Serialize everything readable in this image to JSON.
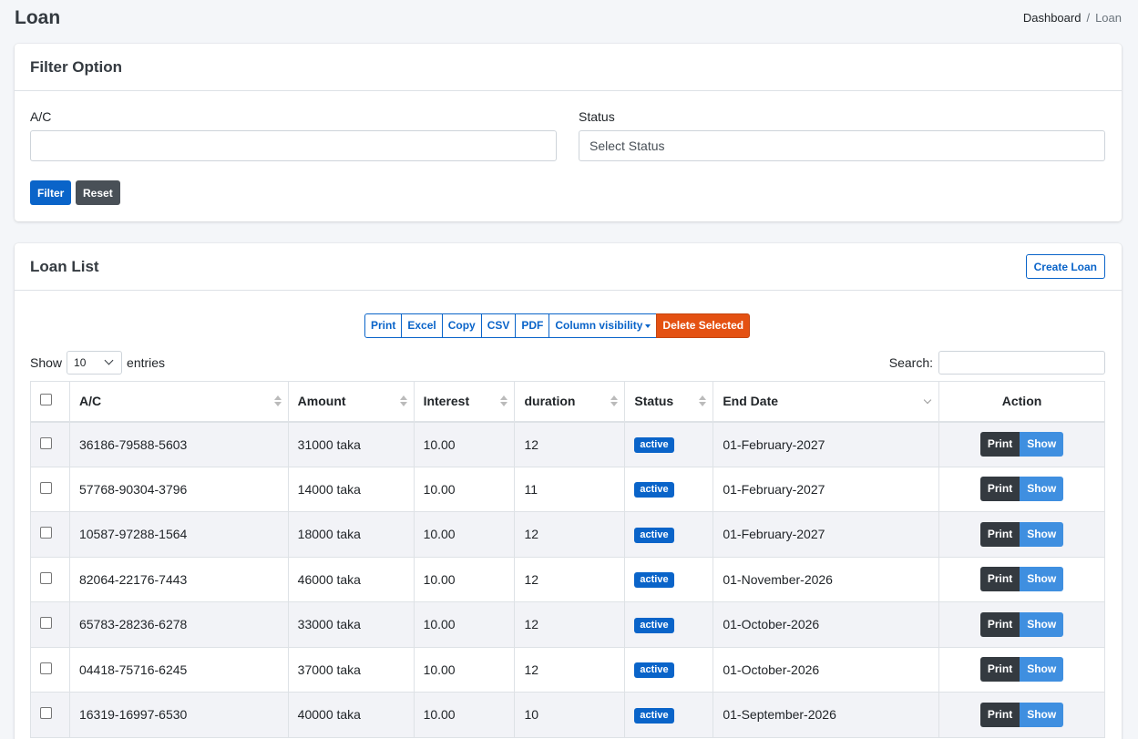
{
  "header": {
    "title": "Loan",
    "breadcrumb": [
      "Dashboard",
      "Loan"
    ]
  },
  "filter": {
    "title": "Filter Option",
    "ac_label": "A/C",
    "ac_value": "",
    "status_label": "Status",
    "status_value": "Select Status",
    "filter_button": "Filter",
    "reset_button": "Reset"
  },
  "list": {
    "title": "Loan List",
    "create_button": "Create Loan",
    "export_buttons": [
      "Print",
      "Excel",
      "Copy",
      "CSV",
      "PDF",
      "Column visibility"
    ],
    "delete_button": "Delete Selected",
    "show_label": "Show",
    "entries_value": "10",
    "entries_label": "entries",
    "search_label": "Search:",
    "columns": [
      "A/C",
      "Amount",
      "Interest",
      "duration",
      "Status",
      "End Date",
      "Action"
    ],
    "row_actions": {
      "print": "Print",
      "show": "Show"
    },
    "rows": [
      {
        "ac": "36186-79588-5603",
        "amount": "31000 taka",
        "interest": "10.00",
        "duration": "12",
        "status": "active",
        "end_date": "01-February-2027"
      },
      {
        "ac": "57768-90304-3796",
        "amount": "14000 taka",
        "interest": "10.00",
        "duration": "11",
        "status": "active",
        "end_date": "01-February-2027"
      },
      {
        "ac": "10587-97288-1564",
        "amount": "18000 taka",
        "interest": "10.00",
        "duration": "12",
        "status": "active",
        "end_date": "01-February-2027"
      },
      {
        "ac": "82064-22176-7443",
        "amount": "46000 taka",
        "interest": "10.00",
        "duration": "12",
        "status": "active",
        "end_date": "01-November-2026"
      },
      {
        "ac": "65783-28236-6278",
        "amount": "33000 taka",
        "interest": "10.00",
        "duration": "12",
        "status": "active",
        "end_date": "01-October-2026"
      },
      {
        "ac": "04418-75716-6245",
        "amount": "37000 taka",
        "interest": "10.00",
        "duration": "12",
        "status": "active",
        "end_date": "01-October-2026"
      },
      {
        "ac": "16319-16997-6530",
        "amount": "40000 taka",
        "interest": "10.00",
        "duration": "10",
        "status": "active",
        "end_date": "01-September-2026"
      }
    ]
  },
  "colors": {
    "primary": "#0a64c9",
    "danger": "#e45112",
    "dark": "#343a40",
    "info": "#3f8fe0"
  }
}
